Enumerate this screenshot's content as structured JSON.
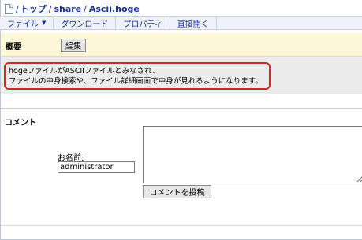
{
  "breadcrumb": {
    "root_sep": "/",
    "items": [
      "トップ",
      "share",
      "Ascii.hoge"
    ],
    "separator": "/"
  },
  "menu": {
    "items": [
      "ファイル",
      "ダウンロード",
      "プロパティ",
      "直接開く"
    ]
  },
  "summary": {
    "title": "概要",
    "edit_label": "編集",
    "text_line1": "hogeファイルがASCIIファイルとみなされ、",
    "text_line2": "ファイルの中身検索や、ファイル詳細画面で中身が見れるようになります。"
  },
  "comments": {
    "title": "コメント",
    "name_label": "お名前:",
    "name_value": "administrator",
    "comment_value": "",
    "post_label": "コメントを投稿"
  },
  "colors": {
    "link": "#1b2f8f",
    "highlight_border": "#d32626",
    "summary_header_bg": "#fbf7d7",
    "summary_body_bg": "#ececec",
    "menubar_bg": "#eef2f8"
  },
  "icons": {
    "breadcrumb": "document-icon",
    "file_menu": "caret-down-icon"
  }
}
